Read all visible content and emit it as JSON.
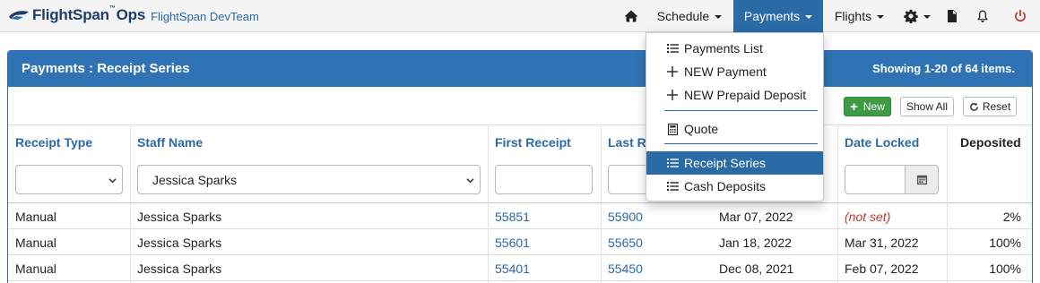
{
  "brand": {
    "name": "FlightSpan",
    "tm": "™",
    "suffix": "Ops",
    "team": "FlightSpan DevTeam"
  },
  "nav": {
    "home_icon": "home-icon",
    "schedule": "Schedule",
    "payments": "Payments",
    "flights": "Flights",
    "settings_icon": "gear-icon",
    "docs_icon": "document-icon",
    "alerts_icon": "bell-icon",
    "power_icon": "power-icon"
  },
  "payments_menu": {
    "items": [
      {
        "label": "Payments List",
        "icon": "list-icon"
      },
      {
        "label": "NEW Payment",
        "icon": "plus-icon"
      },
      {
        "label": "NEW Prepaid Deposit",
        "icon": "plus-icon"
      },
      {
        "label": "Quote",
        "icon": "calculator-icon"
      },
      {
        "label": "Receipt Series",
        "icon": "list-icon"
      },
      {
        "label": "Cash Deposits",
        "icon": "list-icon"
      }
    ]
  },
  "panel": {
    "title": "Payments : Receipt Series",
    "summary": "Showing 1-20 of 64 items."
  },
  "toolbar": {
    "new_label": "New",
    "show_all_label": "Show All",
    "reset_label": "Reset"
  },
  "table": {
    "columns": {
      "receipt_type": "Receipt Type",
      "staff_name": "Staff Name",
      "first_receipt": "First Receipt",
      "last_receipt": "Last R",
      "date_locked": "Date Locked",
      "deposited": "Deposited"
    },
    "filters": {
      "receipt_type": "",
      "staff_name": "Jessica Sparks",
      "first_receipt": "",
      "last_receipt": "",
      "date_locked": ""
    },
    "rows": [
      {
        "receipt_type": "Manual",
        "staff_name": "Jessica Sparks",
        "first_receipt": "55851",
        "last_receipt": "55900",
        "date_created": "Mar 07, 2022",
        "date_locked": "(not set)",
        "deposited": "2%"
      },
      {
        "receipt_type": "Manual",
        "staff_name": "Jessica Sparks",
        "first_receipt": "55601",
        "last_receipt": "55650",
        "date_created": "Jan 18, 2022",
        "date_locked": "Mar 31, 2022",
        "deposited": "100%"
      },
      {
        "receipt_type": "Manual",
        "staff_name": "Jessica Sparks",
        "first_receipt": "55401",
        "last_receipt": "55450",
        "date_created": "Dec 08, 2021",
        "date_locked": "Feb 07, 2022",
        "deposited": "100%"
      }
    ]
  },
  "colors": {
    "primary": "#2a6aa6",
    "header": "#2f73b4",
    "success": "#3c9b45",
    "danger": "#c0392b"
  }
}
